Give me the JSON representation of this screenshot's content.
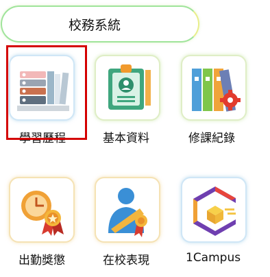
{
  "header": {
    "title": "校務系統"
  },
  "apps": [
    {
      "label": "學習歷程",
      "icon": "portfolio-books-icon"
    },
    {
      "label": "基本資料",
      "icon": "id-badge-icon"
    },
    {
      "label": "修課紀錄",
      "icon": "course-binders-gear-icon"
    },
    {
      "label": "出勤獎懲",
      "icon": "clock-award-icon"
    },
    {
      "label": "在校表現",
      "icon": "student-medal-icon"
    },
    {
      "label": "1Campus",
      "icon": "1campus-cube-icon"
    }
  ],
  "colors": {
    "header_border_start": "#9fe49a",
    "header_border_end": "#e8ee8a",
    "selection_outline": "#d40000"
  }
}
